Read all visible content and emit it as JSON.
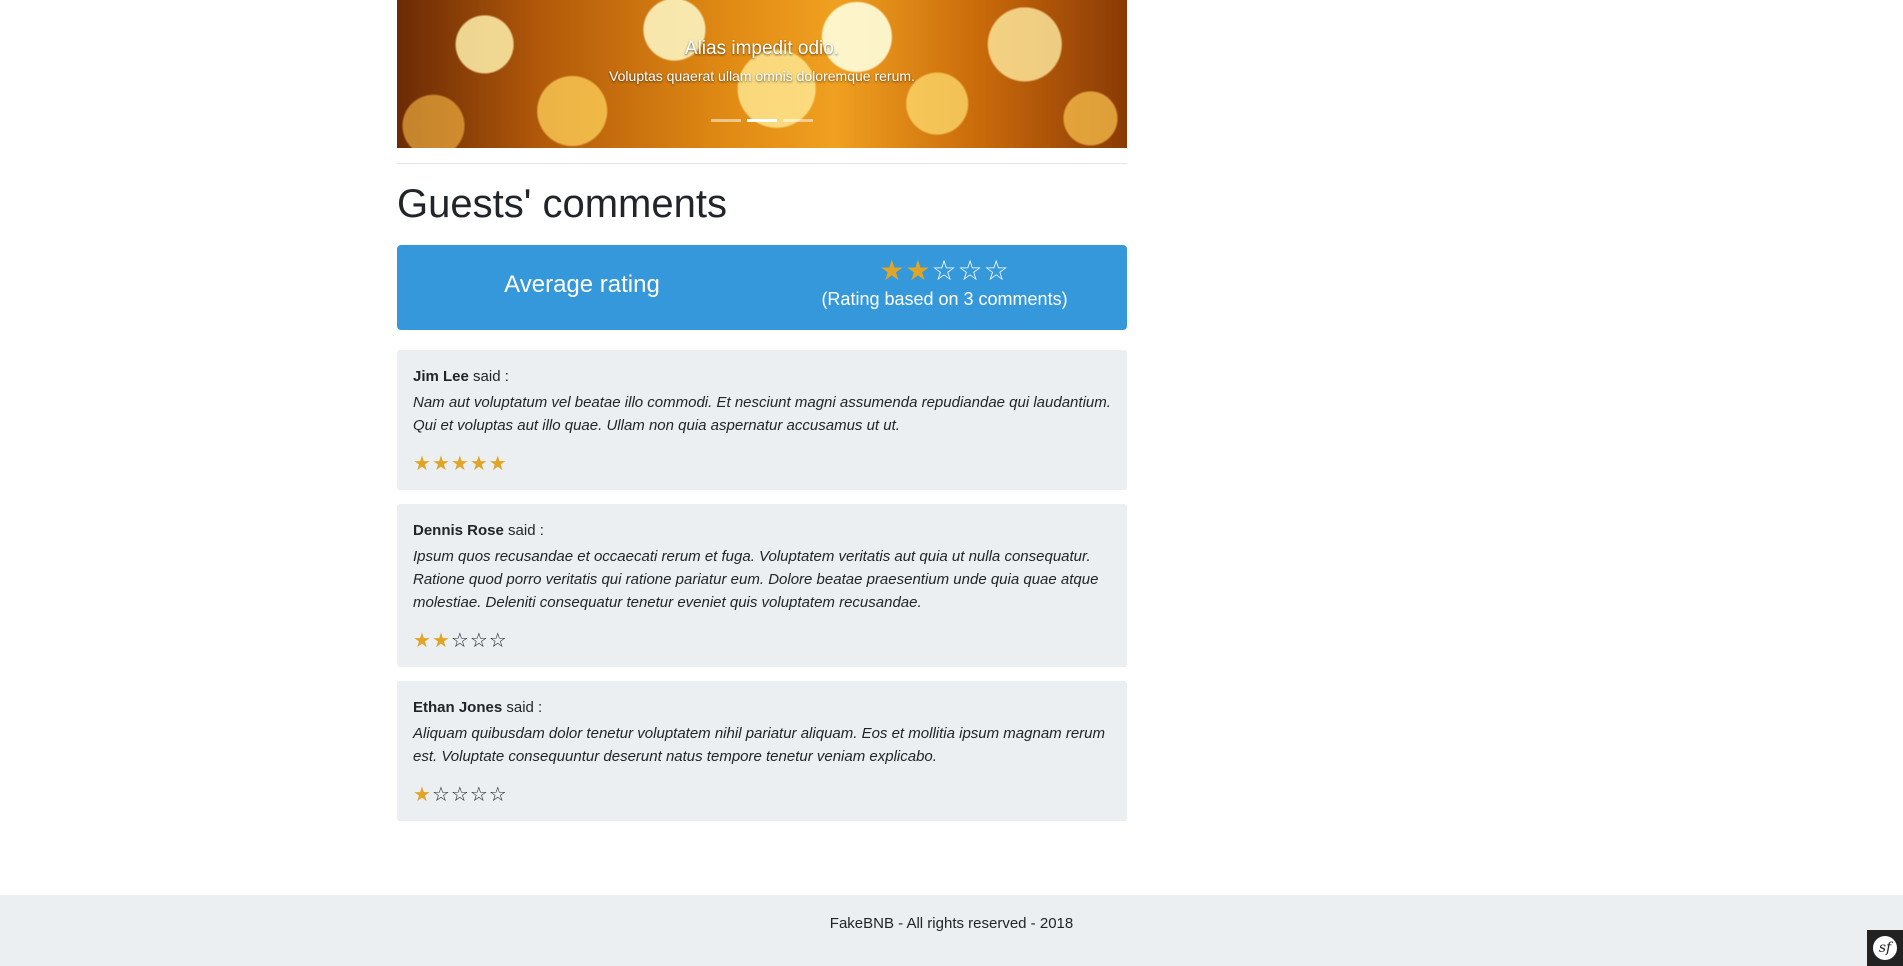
{
  "carousel": {
    "caption_title": "Alias impedit odio.",
    "caption_text": "Voluptas quaerat ullam omnis doloremque rerum.",
    "active_slide": 1,
    "slide_count": 3
  },
  "section": {
    "title": "Guests' comments"
  },
  "average": {
    "label": "Average rating",
    "rating": 2,
    "max": 5,
    "count_text": "(Rating based on 3 comments)"
  },
  "comments": [
    {
      "author": "Jim Lee",
      "said": "said :",
      "text": "Nam aut voluptatum vel beatae illo commodi. Et nesciunt magni assumenda repudiandae qui laudantium. Qui et voluptas aut illo quae. Ullam non quia aspernatur accusamus ut ut.",
      "rating": 5
    },
    {
      "author": "Dennis Rose",
      "said": "said :",
      "text": "Ipsum quos recusandae et occaecati rerum et fuga. Voluptatem veritatis aut quia ut nulla consequatur. Ratione quod porro veritatis qui ratione pariatur eum. Dolore beatae praesentium unde quia quae atque molestiae. Deleniti consequatur tenetur eveniet quis voluptatem recusandae.",
      "rating": 2
    },
    {
      "author": "Ethan Jones",
      "said": "said :",
      "text": "Aliquam quibusdam dolor tenetur voluptatem nihil pariatur aliquam. Eos et mollitia ipsum magnam rerum est. Voluptate consequuntur deserunt natus tempore tenetur veniam explicabo.",
      "rating": 1
    }
  ],
  "footer": {
    "text": "FakeBNB - All rights reserved - 2018"
  },
  "colors": {
    "accent": "#3498db",
    "star": "#e0a526",
    "panel": "#ebeff1"
  },
  "icons": {
    "star_full": "star-icon",
    "star_empty": "star-outline-icon",
    "debug_toolbar": "symfony-icon"
  }
}
